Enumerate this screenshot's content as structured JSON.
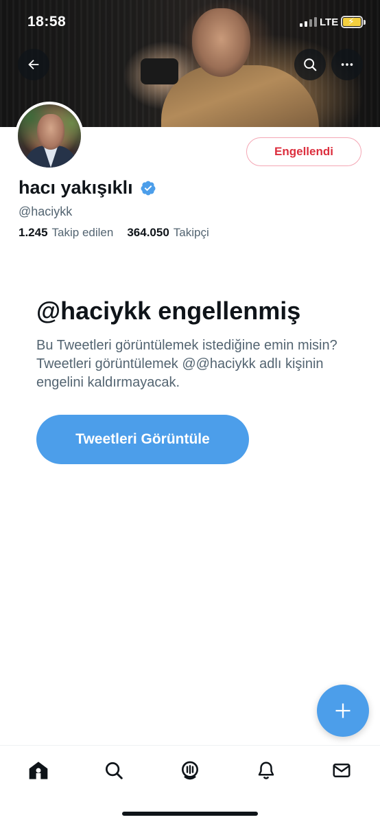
{
  "status_bar": {
    "time": "18:58",
    "network": "LTE",
    "battery": "charging"
  },
  "header": {
    "back_icon": "arrow-left-icon",
    "search_icon": "search-icon",
    "more_icon": "more-horizontal-icon"
  },
  "profile": {
    "name": "hacı yakışıklı",
    "verified": true,
    "handle": "@haciykk",
    "following_count": "1.245",
    "following_label": "Takip edilen",
    "followers_count": "364.050",
    "followers_label": "Takipçi",
    "blocked_button_label": "Engellendi"
  },
  "blocked_notice": {
    "title": "@haciykk engellenmiş",
    "description": "Bu Tweetleri görüntülemek istediğine emin misin? Tweetleri görüntülemek @@haciykk adlı kişinin engelini kaldırmayacak.",
    "button_label": "Tweetleri Görüntüle"
  },
  "fab": {
    "icon": "plus-icon"
  },
  "tabbar": {
    "items": [
      "home-icon",
      "search-icon",
      "spaces-icon",
      "notifications-bell-icon",
      "messages-mail-icon"
    ]
  },
  "colors": {
    "accent": "#4c9eea",
    "blocked_red": "#dc2f3e",
    "text_primary": "#0f1419",
    "text_secondary": "#536471"
  }
}
